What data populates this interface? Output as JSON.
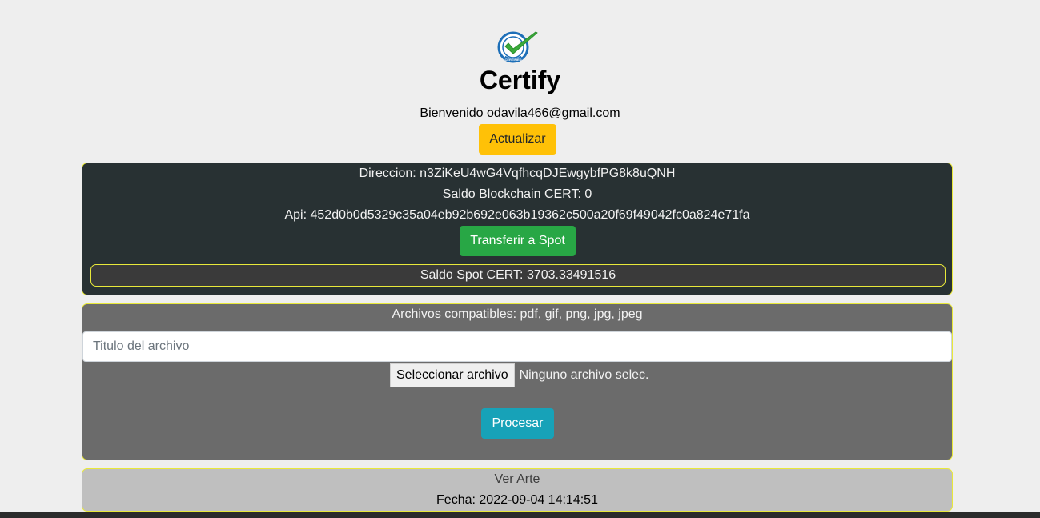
{
  "app": {
    "title": "Certify",
    "welcome": "Bienvenido odavila466@gmail.com",
    "refresh_label": "Actualizar",
    "logo_text": "CERTIFIED"
  },
  "wallet": {
    "direccion": "Direccion: n3ZiKeU4wG4VqfhcqDJEwgybfPG8k8uQNH",
    "saldo_blockchain": "Saldo Blockchain CERT: 0",
    "api": "Api: 452d0b0d5329c35a04eb92b692e063b19362c500a20f69f49042fc0a824e71fa",
    "transfer_label": "Transferir a Spot",
    "saldo_spot": "Saldo Spot CERT: 3703.33491516"
  },
  "upload": {
    "compatible": "Archivos compatibles: pdf, gif, png, jpg, jpeg",
    "title_placeholder": "Titulo del archivo",
    "title_value": "",
    "file_button": "Seleccionar archivo",
    "file_status": "Ninguno archivo selec.",
    "process_label": "Procesar"
  },
  "art": {
    "link_label": "Ver Arte",
    "fecha": "Fecha: 2022-09-04 14:14:51"
  },
  "colors": {
    "background": "#eeeeee",
    "warning": "#ffc107",
    "success": "#28a745",
    "info": "#17a2b8",
    "card_border": "#e8e83a",
    "wallet_bg": "#283133",
    "upload_bg": "#6b6b6b",
    "art_bg": "#bfbfbf"
  },
  "icons": {
    "logo": "certified-check-icon"
  }
}
